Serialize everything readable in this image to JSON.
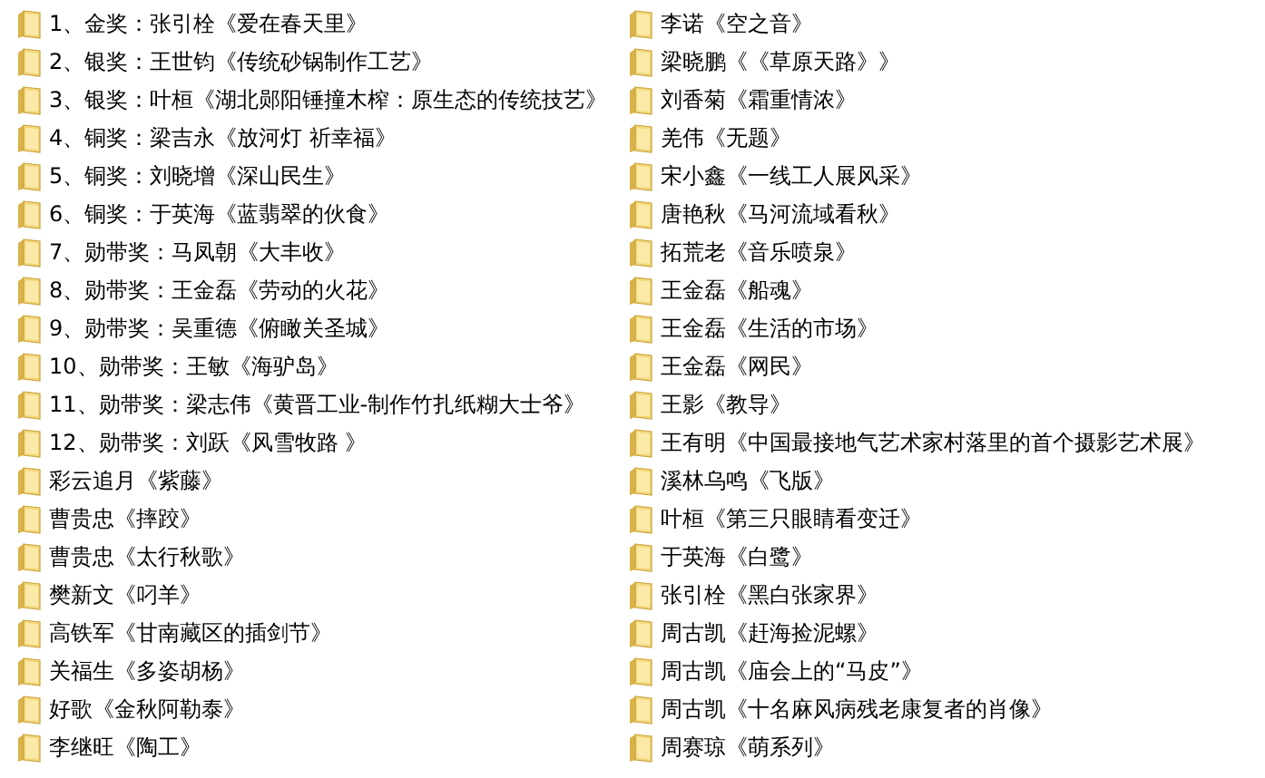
{
  "columns": [
    {
      "items": [
        {
          "name": "1、金奖：张引栓《爱在春天里》"
        },
        {
          "name": "2、银奖：王世钧《传统砂锅制作工艺》"
        },
        {
          "name": "3、银奖：叶桓《湖北郧阳锤撞木榨：原生态的传统技艺》"
        },
        {
          "name": "4、铜奖：梁吉永《放河灯 祈幸福》"
        },
        {
          "name": "5、铜奖：刘晓增《深山民生》"
        },
        {
          "name": "6、铜奖：于英海《蓝翡翠的伙食》"
        },
        {
          "name": "7、勋带奖：马凤朝《大丰收》"
        },
        {
          "name": "8、勋带奖：王金磊《劳动的火花》"
        },
        {
          "name": "9、勋带奖：吴重德《俯瞰关圣城》"
        },
        {
          "name": "10、勋带奖：王敏《海驴岛》"
        },
        {
          "name": "11、勋带奖：梁志伟《黄晋工业-制作竹扎纸糊大士爷》"
        },
        {
          "name": "12、勋带奖：刘跃《风雪牧路 》"
        },
        {
          "name": "彩云追月《紫藤》"
        },
        {
          "name": "曹贵忠《摔跤》"
        },
        {
          "name": "曹贵忠《太行秋歌》"
        },
        {
          "name": "樊新文《叼羊》"
        },
        {
          "name": "高铁军《甘南藏区的插剑节》"
        },
        {
          "name": "关福生《多姿胡杨》"
        },
        {
          "name": "好歌《金秋阿勒泰》"
        },
        {
          "name": "李继旺《陶工》"
        }
      ]
    },
    {
      "items": [
        {
          "name": "李诺《空之音》"
        },
        {
          "name": "梁晓鹏《《草原天路》》"
        },
        {
          "name": "刘香菊《霜重情浓》"
        },
        {
          "name": "羌伟《无题》"
        },
        {
          "name": "宋小鑫《一线工人展风采》"
        },
        {
          "name": "唐艳秋《马河流域看秋》"
        },
        {
          "name": "拓荒老《音乐喷泉》"
        },
        {
          "name": "王金磊《船魂》"
        },
        {
          "name": "王金磊《生活的市场》"
        },
        {
          "name": "王金磊《网民》"
        },
        {
          "name": "王影《教导》"
        },
        {
          "name": "王有明《中国最接地气艺术家村落里的首个摄影艺术展》"
        },
        {
          "name": "溪林乌鸣《飞版》"
        },
        {
          "name": "叶桓《第三只眼睛看变迁》"
        },
        {
          "name": "于英海《白鹭》"
        },
        {
          "name": "张引栓《黑白张家界》"
        },
        {
          "name": "周古凯《赶海捡泥螺》"
        },
        {
          "name": "周古凯《庙会上的“马皮”》"
        },
        {
          "name": "周古凯《十名麻风病残老康复者的肖像》"
        },
        {
          "name": "周赛琼《萌系列》"
        }
      ]
    }
  ]
}
